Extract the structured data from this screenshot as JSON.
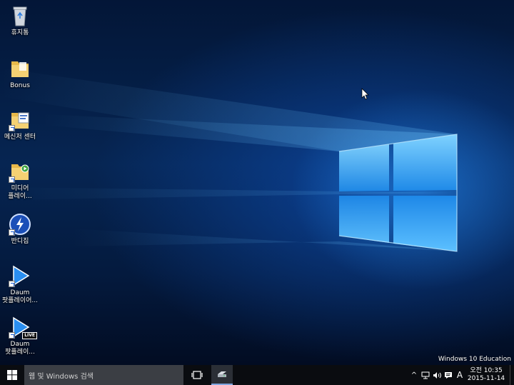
{
  "desktop": {
    "icons": [
      {
        "label": "휴지통",
        "icon": "recycle-bin-icon"
      },
      {
        "label": "Bonus",
        "icon": "folder-icon"
      },
      {
        "label": "메신저 센터",
        "icon": "messenger-center-icon"
      },
      {
        "label": "미디어\n플레이...",
        "icon": "media-player-icon"
      },
      {
        "label": "반디집",
        "icon": "bandizip-icon"
      },
      {
        "label": "Daum\n팟플레이어...",
        "icon": "potplayer-icon"
      },
      {
        "label": "Daum\n팟플레이...",
        "icon": "potplayer-live-icon"
      }
    ],
    "live_badge": "LIVE",
    "watermark": "Windows 10 Education"
  },
  "taskbar": {
    "start_icon": "windows-logo-icon",
    "search_placeholder": "웹 및 Windows 검색",
    "task_view_icon": "task-view-icon",
    "pinned_app_icon": "drive-icon",
    "tray": {
      "chevron": "^",
      "network_icon": "network-icon",
      "volume_icon": "volume-icon",
      "action_center_icon": "action-center-icon",
      "ime_indicator": "A"
    },
    "clock": {
      "time": "오전 10:35",
      "date": "2015-11-14"
    }
  },
  "colors": {
    "taskbar": "#0a0c10",
    "search_box": "#3b3e44",
    "accent": "#7ea6e0"
  }
}
